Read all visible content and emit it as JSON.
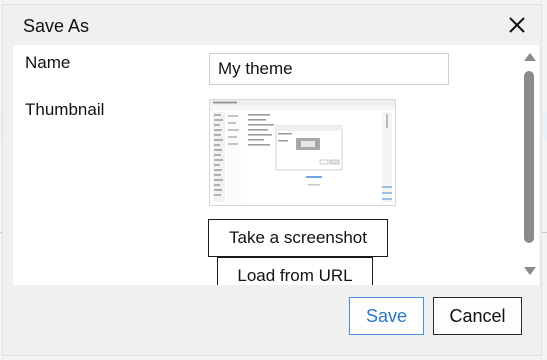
{
  "dialog": {
    "title": "Save As",
    "close_icon": "close-icon"
  },
  "form": {
    "name_label": "Name",
    "name_value": "My theme",
    "thumbnail_label": "Thumbnail",
    "thumbnail_icon": "thumbnail-screenshot-image",
    "take_screenshot_label": "Take a screenshot",
    "load_from_url_label": "Load from URL"
  },
  "scrollbar": {
    "up_icon": "scroll-up-arrow-icon",
    "down_icon": "scroll-down-arrow-icon"
  },
  "footer": {
    "save_label": "Save",
    "cancel_label": "Cancel"
  },
  "colors": {
    "accent": "#4a90d9",
    "dialog_bg": "#f0f0f0",
    "content_bg": "#ffffff"
  }
}
